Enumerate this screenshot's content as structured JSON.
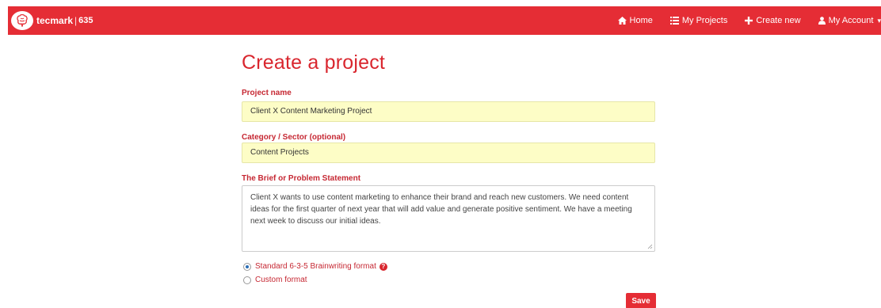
{
  "navbar": {
    "brand_name": "tecmark",
    "brand_separator": "|",
    "brand_number": "635",
    "logo_icon": "brain-icon",
    "links": [
      {
        "label": "Home",
        "icon": "home-icon"
      },
      {
        "label": "My Projects",
        "icon": "list-icon"
      },
      {
        "label": "Create new",
        "icon": "plus-icon"
      },
      {
        "label": "My Account",
        "icon": "user-icon",
        "caret": "▾"
      }
    ]
  },
  "page": {
    "title": "Create a project"
  },
  "form": {
    "project_name_label": "Project name",
    "project_name_value": "Client X Content Marketing Project",
    "category_label": "Category / Sector (optional)",
    "category_value": "Content Projects",
    "brief_label": "The Brief or Problem Statement",
    "brief_value": "Client X wants to use content marketing to enhance their brand and reach new customers. We need content ideas for the first quarter of next year that will add value and generate positive sentiment. We have a meeting next week to discuss our initial ideas.",
    "format_options": [
      {
        "label": "Standard 6-3-5 Brainwriting format",
        "checked": true
      },
      {
        "label": "Custom format",
        "checked": false
      }
    ],
    "help_icon_glyph": "?",
    "save_label": "Save"
  },
  "colors": {
    "brand_red": "#e52d35",
    "label_red": "#c62833",
    "input_highlight": "#fdfdc6"
  }
}
